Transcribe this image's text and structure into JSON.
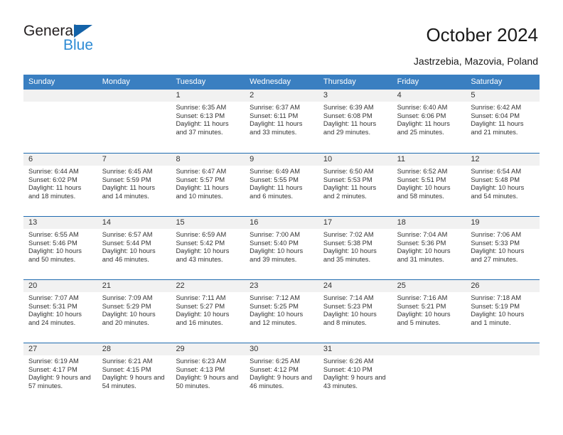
{
  "brand": {
    "name_dark": "General",
    "name_blue": "Blue",
    "color_dark": "#231f20",
    "color_blue": "#2e8bd4",
    "triangle_color": "#1362a8"
  },
  "header": {
    "title": "October 2024",
    "subtitle": "Jastrzebia, Mazovia, Poland"
  },
  "theme": {
    "header_row_bg": "#3a7fc1",
    "header_row_text": "#ffffff",
    "day_band_bg": "#f1f1f1",
    "row_divider": "#1f6bb0",
    "body_text": "#333333"
  },
  "weekdays": [
    "Sunday",
    "Monday",
    "Tuesday",
    "Wednesday",
    "Thursday",
    "Friday",
    "Saturday"
  ],
  "weeks": [
    [
      {
        "day": "",
        "sunrise": "",
        "sunset": "",
        "daylight": ""
      },
      {
        "day": "",
        "sunrise": "",
        "sunset": "",
        "daylight": ""
      },
      {
        "day": "1",
        "sunrise": "Sunrise: 6:35 AM",
        "sunset": "Sunset: 6:13 PM",
        "daylight": "Daylight: 11 hours and 37 minutes."
      },
      {
        "day": "2",
        "sunrise": "Sunrise: 6:37 AM",
        "sunset": "Sunset: 6:11 PM",
        "daylight": "Daylight: 11 hours and 33 minutes."
      },
      {
        "day": "3",
        "sunrise": "Sunrise: 6:39 AM",
        "sunset": "Sunset: 6:08 PM",
        "daylight": "Daylight: 11 hours and 29 minutes."
      },
      {
        "day": "4",
        "sunrise": "Sunrise: 6:40 AM",
        "sunset": "Sunset: 6:06 PM",
        "daylight": "Daylight: 11 hours and 25 minutes."
      },
      {
        "day": "5",
        "sunrise": "Sunrise: 6:42 AM",
        "sunset": "Sunset: 6:04 PM",
        "daylight": "Daylight: 11 hours and 21 minutes."
      }
    ],
    [
      {
        "day": "6",
        "sunrise": "Sunrise: 6:44 AM",
        "sunset": "Sunset: 6:02 PM",
        "daylight": "Daylight: 11 hours and 18 minutes."
      },
      {
        "day": "7",
        "sunrise": "Sunrise: 6:45 AM",
        "sunset": "Sunset: 5:59 PM",
        "daylight": "Daylight: 11 hours and 14 minutes."
      },
      {
        "day": "8",
        "sunrise": "Sunrise: 6:47 AM",
        "sunset": "Sunset: 5:57 PM",
        "daylight": "Daylight: 11 hours and 10 minutes."
      },
      {
        "day": "9",
        "sunrise": "Sunrise: 6:49 AM",
        "sunset": "Sunset: 5:55 PM",
        "daylight": "Daylight: 11 hours and 6 minutes."
      },
      {
        "day": "10",
        "sunrise": "Sunrise: 6:50 AM",
        "sunset": "Sunset: 5:53 PM",
        "daylight": "Daylight: 11 hours and 2 minutes."
      },
      {
        "day": "11",
        "sunrise": "Sunrise: 6:52 AM",
        "sunset": "Sunset: 5:51 PM",
        "daylight": "Daylight: 10 hours and 58 minutes."
      },
      {
        "day": "12",
        "sunrise": "Sunrise: 6:54 AM",
        "sunset": "Sunset: 5:48 PM",
        "daylight": "Daylight: 10 hours and 54 minutes."
      }
    ],
    [
      {
        "day": "13",
        "sunrise": "Sunrise: 6:55 AM",
        "sunset": "Sunset: 5:46 PM",
        "daylight": "Daylight: 10 hours and 50 minutes."
      },
      {
        "day": "14",
        "sunrise": "Sunrise: 6:57 AM",
        "sunset": "Sunset: 5:44 PM",
        "daylight": "Daylight: 10 hours and 46 minutes."
      },
      {
        "day": "15",
        "sunrise": "Sunrise: 6:59 AM",
        "sunset": "Sunset: 5:42 PM",
        "daylight": "Daylight: 10 hours and 43 minutes."
      },
      {
        "day": "16",
        "sunrise": "Sunrise: 7:00 AM",
        "sunset": "Sunset: 5:40 PM",
        "daylight": "Daylight: 10 hours and 39 minutes."
      },
      {
        "day": "17",
        "sunrise": "Sunrise: 7:02 AM",
        "sunset": "Sunset: 5:38 PM",
        "daylight": "Daylight: 10 hours and 35 minutes."
      },
      {
        "day": "18",
        "sunrise": "Sunrise: 7:04 AM",
        "sunset": "Sunset: 5:36 PM",
        "daylight": "Daylight: 10 hours and 31 minutes."
      },
      {
        "day": "19",
        "sunrise": "Sunrise: 7:06 AM",
        "sunset": "Sunset: 5:33 PM",
        "daylight": "Daylight: 10 hours and 27 minutes."
      }
    ],
    [
      {
        "day": "20",
        "sunrise": "Sunrise: 7:07 AM",
        "sunset": "Sunset: 5:31 PM",
        "daylight": "Daylight: 10 hours and 24 minutes."
      },
      {
        "day": "21",
        "sunrise": "Sunrise: 7:09 AM",
        "sunset": "Sunset: 5:29 PM",
        "daylight": "Daylight: 10 hours and 20 minutes."
      },
      {
        "day": "22",
        "sunrise": "Sunrise: 7:11 AM",
        "sunset": "Sunset: 5:27 PM",
        "daylight": "Daylight: 10 hours and 16 minutes."
      },
      {
        "day": "23",
        "sunrise": "Sunrise: 7:12 AM",
        "sunset": "Sunset: 5:25 PM",
        "daylight": "Daylight: 10 hours and 12 minutes."
      },
      {
        "day": "24",
        "sunrise": "Sunrise: 7:14 AM",
        "sunset": "Sunset: 5:23 PM",
        "daylight": "Daylight: 10 hours and 8 minutes."
      },
      {
        "day": "25",
        "sunrise": "Sunrise: 7:16 AM",
        "sunset": "Sunset: 5:21 PM",
        "daylight": "Daylight: 10 hours and 5 minutes."
      },
      {
        "day": "26",
        "sunrise": "Sunrise: 7:18 AM",
        "sunset": "Sunset: 5:19 PM",
        "daylight": "Daylight: 10 hours and 1 minute."
      }
    ],
    [
      {
        "day": "27",
        "sunrise": "Sunrise: 6:19 AM",
        "sunset": "Sunset: 4:17 PM",
        "daylight": "Daylight: 9 hours and 57 minutes."
      },
      {
        "day": "28",
        "sunrise": "Sunrise: 6:21 AM",
        "sunset": "Sunset: 4:15 PM",
        "daylight": "Daylight: 9 hours and 54 minutes."
      },
      {
        "day": "29",
        "sunrise": "Sunrise: 6:23 AM",
        "sunset": "Sunset: 4:13 PM",
        "daylight": "Daylight: 9 hours and 50 minutes."
      },
      {
        "day": "30",
        "sunrise": "Sunrise: 6:25 AM",
        "sunset": "Sunset: 4:12 PM",
        "daylight": "Daylight: 9 hours and 46 minutes."
      },
      {
        "day": "31",
        "sunrise": "Sunrise: 6:26 AM",
        "sunset": "Sunset: 4:10 PM",
        "daylight": "Daylight: 9 hours and 43 minutes."
      },
      {
        "day": "",
        "sunrise": "",
        "sunset": "",
        "daylight": ""
      },
      {
        "day": "",
        "sunrise": "",
        "sunset": "",
        "daylight": ""
      }
    ]
  ]
}
